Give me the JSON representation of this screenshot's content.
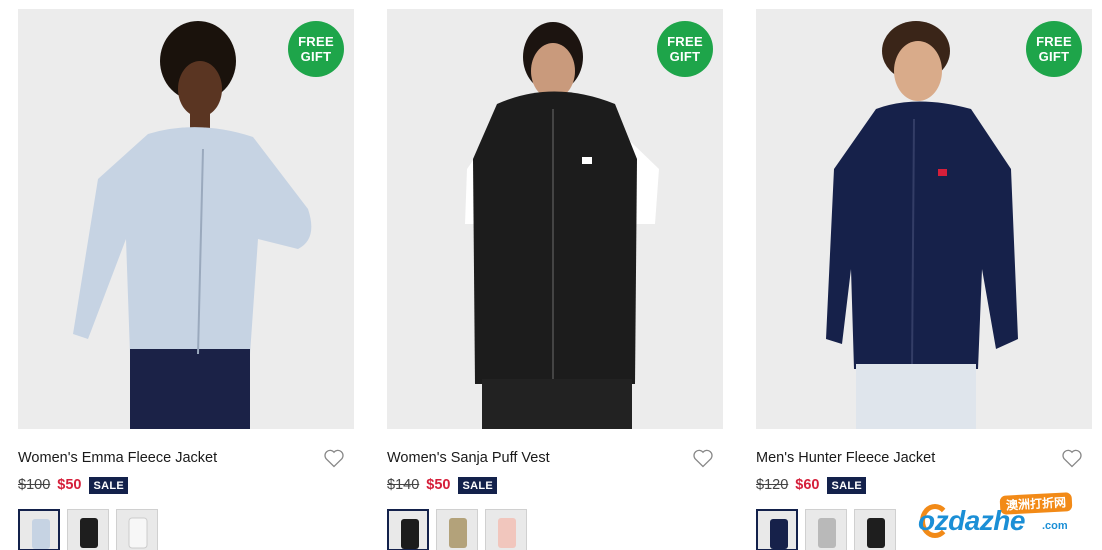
{
  "badge": {
    "line1": "FREE",
    "line2": "GIFT"
  },
  "sale_label": "SALE",
  "products": [
    {
      "name": "Women's Emma Fleece Jacket",
      "old_price": "$100",
      "new_price": "$50",
      "garment_color": "#c6d3e3",
      "swatch_colors": [
        "#c6d3e3",
        "#1e1e1e",
        "#f7f7f7"
      ],
      "selected_swatch": 0
    },
    {
      "name": "Women's Sanja Puff Vest",
      "old_price": "$140",
      "new_price": "$50",
      "garment_color": "#1c1c1c",
      "swatch_colors": [
        "#1c1c1c",
        "#b3a27a",
        "#f1c6bd"
      ],
      "selected_swatch": 0
    },
    {
      "name": "Men's Hunter Fleece Jacket",
      "old_price": "$120",
      "new_price": "$60",
      "garment_color": "#16214a",
      "swatch_colors": [
        "#16214a",
        "#b9b9b9",
        "#1e1e1e"
      ],
      "selected_swatch": 0
    }
  ],
  "colors": {
    "gift_badge": "#1ea54a",
    "sale_badge": "#13214b",
    "sale_price": "#d51f3a"
  },
  "icons": {
    "wishlist": "heart-outline-icon"
  },
  "watermark": {
    "tag": "澳洲打折网",
    "main": "ozdazhe",
    "suffix": ".com"
  }
}
